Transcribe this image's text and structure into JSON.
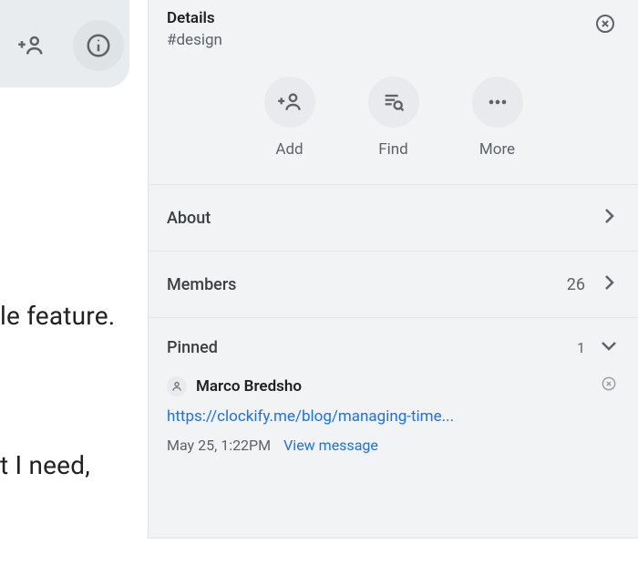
{
  "toolbar": {
    "add_user_icon": "person-add-icon",
    "info_icon": "info-icon"
  },
  "background_text": {
    "line1": "le feature.",
    "line2": "t I need,"
  },
  "panel": {
    "title": "Details",
    "subtitle": "#design",
    "close_icon": "close-circle-icon",
    "actions": {
      "add": {
        "label": "Add",
        "icon": "person-add-icon"
      },
      "find": {
        "label": "Find",
        "icon": "search-list-icon"
      },
      "more": {
        "label": "More",
        "icon": "more-horiz-icon"
      }
    },
    "sections": {
      "about": {
        "label": "About"
      },
      "members": {
        "label": "Members",
        "count": "26"
      }
    },
    "pinned": {
      "label": "Pinned",
      "count": "1",
      "items": [
        {
          "author": "Marco Bredsho",
          "url": "https://clockify.me/blog/managing-time...",
          "date": "May 25, 1:22PM",
          "view_label": "View message"
        }
      ]
    }
  }
}
